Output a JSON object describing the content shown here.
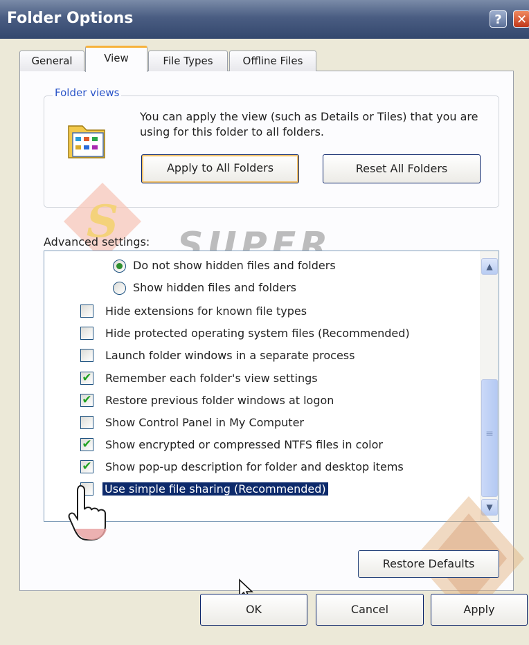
{
  "window": {
    "title": "Folder Options"
  },
  "title_buttons": {
    "help": "?",
    "close": "✕"
  },
  "tabs": [
    {
      "label": "General"
    },
    {
      "label": "View"
    },
    {
      "label": "File Types"
    },
    {
      "label": "Offline Files"
    }
  ],
  "folder_views": {
    "group_title": "Folder views",
    "description": "You can apply the view (such as Details or Tiles) that you are using for this folder to all folders.",
    "apply_button": "Apply to All Folders",
    "reset_button": "Reset All Folders"
  },
  "advanced": {
    "label": "Advanced settings:",
    "items": [
      {
        "type": "radio",
        "checked": true,
        "label": "Do not show hidden files and folders"
      },
      {
        "type": "radio",
        "checked": false,
        "label": "Show hidden files and folders"
      },
      {
        "type": "checkbox",
        "checked": false,
        "label": "Hide extensions for known file types"
      },
      {
        "type": "checkbox",
        "checked": false,
        "label": "Hide protected operating system files (Recommended)"
      },
      {
        "type": "checkbox",
        "checked": false,
        "label": "Launch folder windows in a separate process"
      },
      {
        "type": "checkbox",
        "checked": true,
        "label": "Remember each folder's view settings"
      },
      {
        "type": "checkbox",
        "checked": true,
        "label": "Restore previous folder windows at logon"
      },
      {
        "type": "checkbox",
        "checked": false,
        "label": "Show Control Panel in My Computer"
      },
      {
        "type": "checkbox",
        "checked": true,
        "label": "Show encrypted or compressed NTFS files in color"
      },
      {
        "type": "checkbox",
        "checked": true,
        "label": "Show pop-up description for folder and desktop items"
      },
      {
        "type": "checkbox",
        "checked": false,
        "label": "Use simple file sharing (Recommended)",
        "selected": true
      }
    ],
    "restore_button": "Restore Defaults"
  },
  "footer": {
    "ok": "OK",
    "cancel": "Cancel",
    "apply": "Apply"
  },
  "watermark": {
    "text": "SUPER COMPUTER",
    "badge": "S"
  },
  "check_glyph": "✔",
  "scroll_icons": {
    "up": "▲",
    "down": "▼",
    "grip": "≡"
  }
}
